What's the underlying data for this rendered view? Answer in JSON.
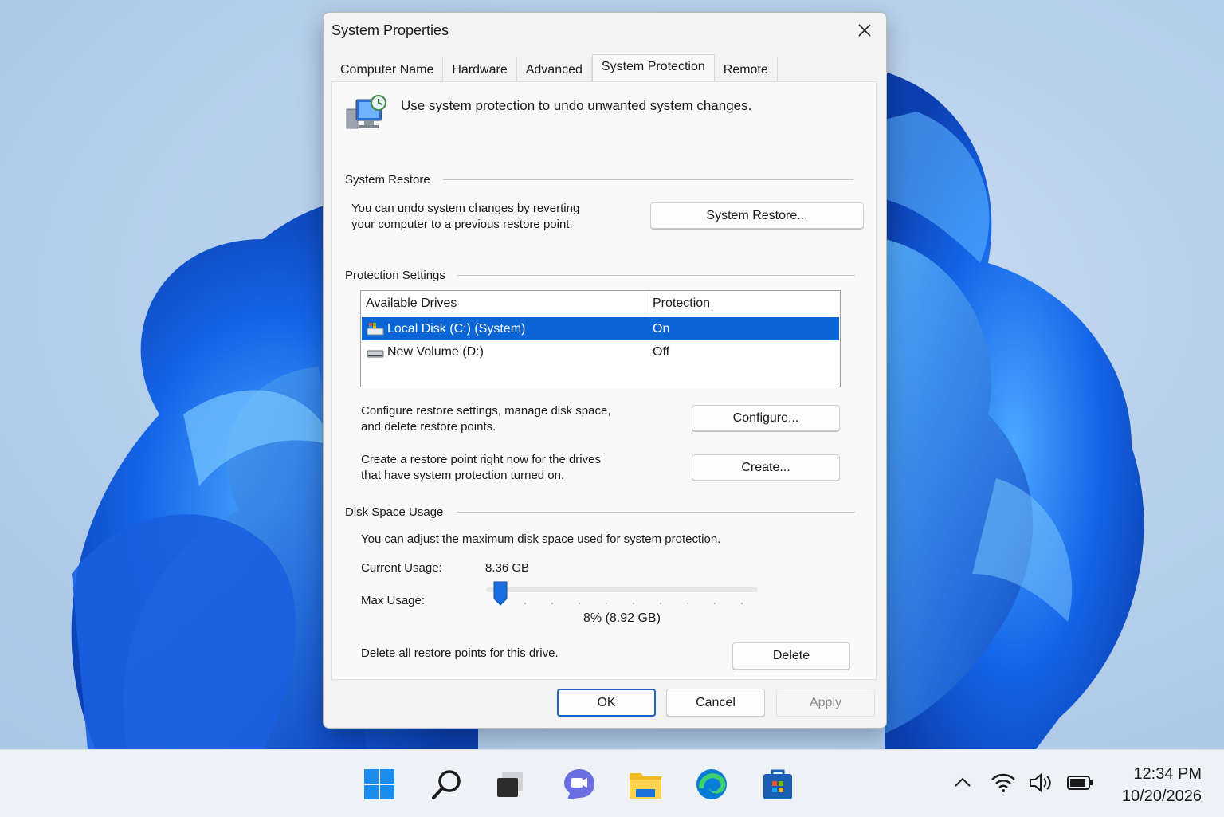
{
  "window": {
    "title": "System Properties"
  },
  "tabs": [
    {
      "label": "Computer Name"
    },
    {
      "label": "Hardware"
    },
    {
      "label": "Advanced"
    },
    {
      "label": "System Protection",
      "active": true
    },
    {
      "label": "Remote"
    }
  ],
  "intro": {
    "text": "Use system protection to undo unwanted system changes."
  },
  "system_restore": {
    "group_label": "System Restore",
    "desc_line1": "You can undo system changes by reverting",
    "desc_line2": "your computer to a previous restore point.",
    "button_label": "System Restore..."
  },
  "protection": {
    "group_label": "Protection Settings",
    "columns": [
      "Available Drives",
      "Protection"
    ],
    "drives": [
      {
        "name": "Local Disk (C:) (System)",
        "protection": "On",
        "selected": true
      },
      {
        "name": "New Volume (D:)",
        "protection": "Off",
        "selected": false
      }
    ],
    "configure_desc_line1": "Configure restore settings, manage disk space,",
    "configure_desc_line2": "and delete restore points.",
    "configure_label": "Configure...",
    "create_desc_line1": "Create a restore point right now for the drives",
    "create_desc_line2": "that have system protection turned on.",
    "create_label": "Create..."
  },
  "disk": {
    "group_label": "Disk Space Usage",
    "desc": "You can adjust the maximum disk space used for system protection.",
    "current_label": "Current Usage:",
    "current_value": "8.36 GB",
    "max_label": "Max Usage:",
    "max_value_text": "8% (8.92 GB)",
    "max_percent": 8,
    "delete_desc": "Delete all restore points for this drive.",
    "delete_label": "Delete"
  },
  "footer": {
    "ok": "OK",
    "cancel": "Cancel",
    "apply": "Apply"
  },
  "taskbar": {
    "apps": [
      "windows-start-icon",
      "search-icon",
      "task-view-icon",
      "teams-chat-icon",
      "file-explorer-icon",
      "edge-icon",
      "store-icon"
    ],
    "time": "12:34 PM",
    "date": "10/20/2026"
  },
  "colors": {
    "accent": "#0a65d6",
    "selection": "#0a65d6"
  }
}
